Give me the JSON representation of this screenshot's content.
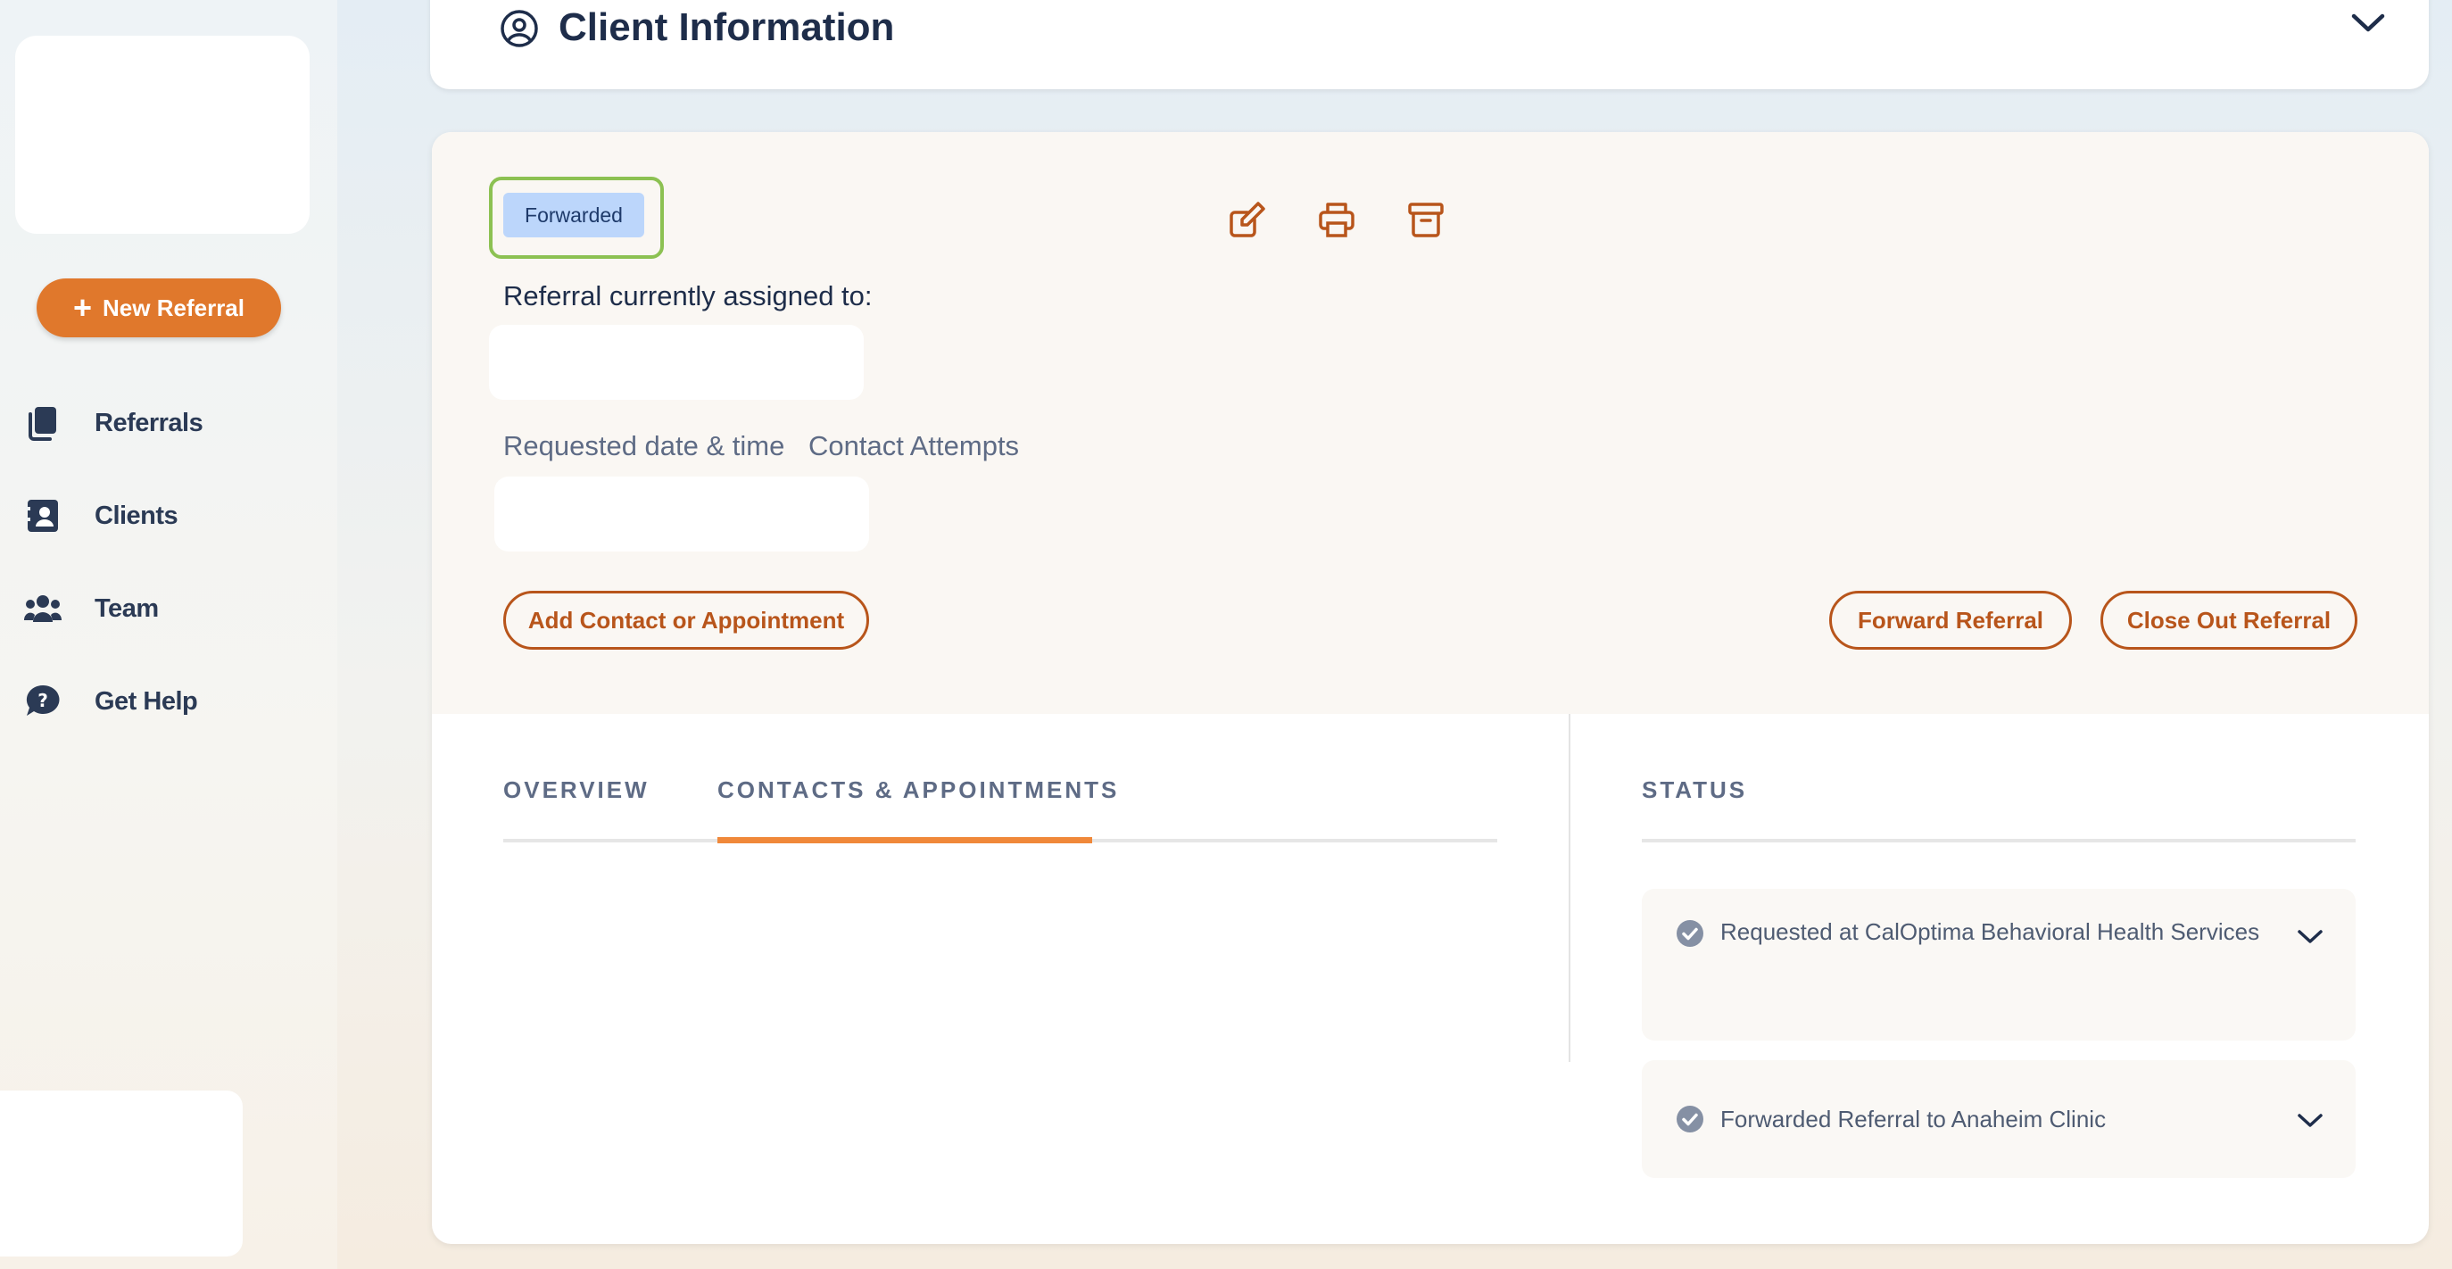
{
  "sidebar": {
    "new_referral_label": "New Referral",
    "items": [
      {
        "label": "Referrals",
        "icon": "copy-document-icon"
      },
      {
        "label": "Clients",
        "icon": "address-book-icon"
      },
      {
        "label": "Team",
        "icon": "users-icon"
      },
      {
        "label": "Get Help",
        "icon": "question-bubble-icon"
      }
    ]
  },
  "client_info": {
    "title": "Client Information"
  },
  "referral": {
    "status_badge": "Forwarded",
    "assigned_label": "Referral currently assigned to:",
    "requested_label": "Requested date & time",
    "contact_attempts_label": "Contact Attempts",
    "buttons": {
      "add_contact": "Add Contact or Appointment",
      "forward": "Forward Referral",
      "close_out": "Close Out Referral"
    }
  },
  "tabs": [
    {
      "label": "OVERVIEW",
      "active": false
    },
    {
      "label": "CONTACTS & APPOINTMENTS",
      "active": true
    }
  ],
  "status": {
    "title": "STATUS",
    "items": [
      {
        "text": "Requested at CalOptima Behavioral Health Services"
      },
      {
        "text": "Forwarded Referral to Anaheim Clinic"
      }
    ]
  },
  "colors": {
    "accent_orange": "#e0782c",
    "outline_orange": "#b8551b",
    "badge_blue": "#bcd6fb",
    "highlight_green": "#8cc152",
    "tab_underline": "#f0883a"
  }
}
